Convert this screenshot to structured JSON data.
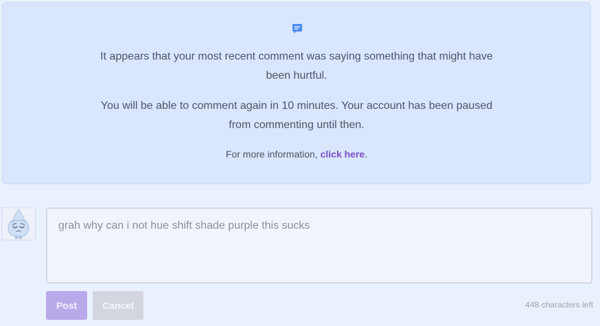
{
  "notice": {
    "icon": "comment-icon",
    "message_line1": "It appears that your most recent comment was saying something that might have",
    "message_line2": "been hurtful.",
    "pause_line1": "You will be able to comment again in 10 minutes. Your account has been paused",
    "pause_line2": "from commenting until then.",
    "more_info_prefix": "For more information, ",
    "more_info_link": "click here",
    "more_info_suffix": "."
  },
  "comment": {
    "avatar": "avatar-icon",
    "text": "grah why can i not hue shift shade purple this sucks",
    "post_label": "Post",
    "cancel_label": "Cancel",
    "chars_left": "448 characters left"
  },
  "colors": {
    "notice_bg": "#d9e6fd",
    "link": "#7c4fc9",
    "post_button": "#b9a8ea",
    "icon_blue": "#4a8bf0"
  }
}
